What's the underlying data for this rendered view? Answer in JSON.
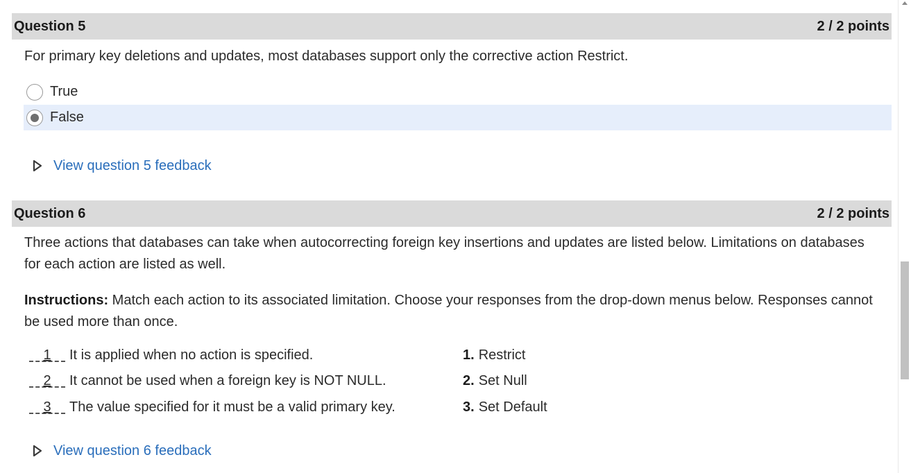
{
  "question5": {
    "title": "Question 5",
    "points": "2 / 2 points",
    "prompt": "For primary key deletions and updates, most databases support only the corrective action Restrict.",
    "options": [
      {
        "label": "True",
        "selected": false
      },
      {
        "label": "False",
        "selected": true
      }
    ],
    "feedback_link": "View question 5 feedback"
  },
  "question6": {
    "title": "Question 6",
    "points": "2 / 2 points",
    "prompt": "Three actions that databases can take when autocorrecting foreign key insertions and updates are listed below. Limitations on databases for each action are listed as well.",
    "instructions_label": "Instructions:",
    "instructions_text": " Match each action to its associated limitation. Choose your responses from the drop-down menus below. Responses cannot be used more than once.",
    "matches": [
      {
        "answer": "1",
        "text": "It is applied when no action is specified."
      },
      {
        "answer": "2",
        "text": "It cannot be used when a foreign key is NOT NULL."
      },
      {
        "answer": "3",
        "text": "The value specified for it must be a valid primary key."
      }
    ],
    "choices": [
      {
        "num": "1.",
        "label": "Restrict"
      },
      {
        "num": "2.",
        "label": "Set Null"
      },
      {
        "num": "3.",
        "label": "Set Default"
      }
    ],
    "feedback_link": "View question 6 feedback"
  },
  "colors": {
    "header_bg": "#dadada",
    "selected_bg": "#e6eefb",
    "link": "#2a6ebb"
  }
}
